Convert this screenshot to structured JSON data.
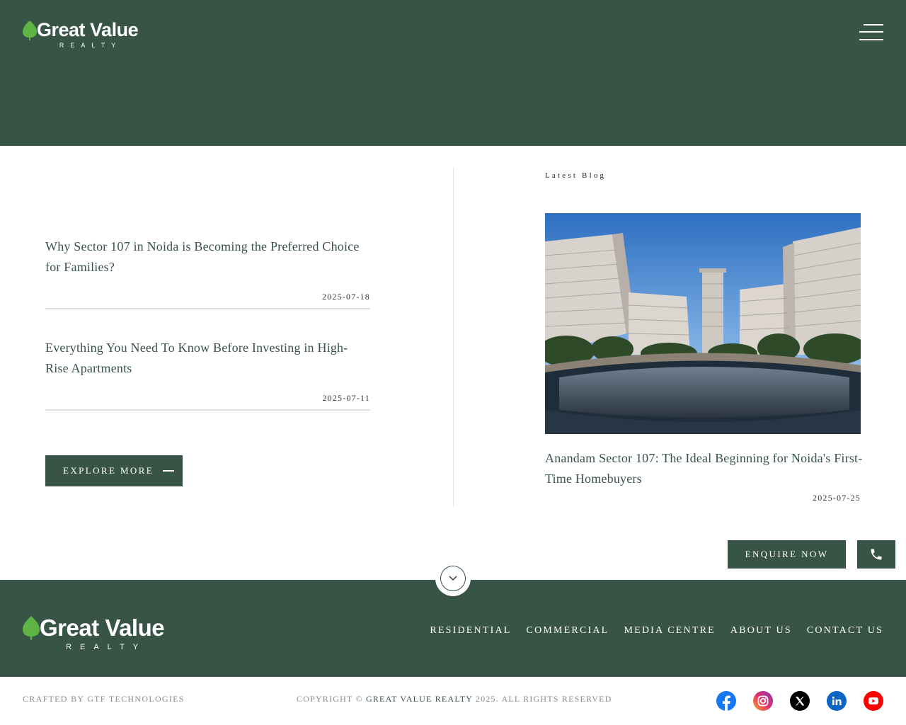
{
  "brand": {
    "name": "Great Value",
    "tagline": "REALTY"
  },
  "header": {
    "menu_icon": "hamburger-menu-icon"
  },
  "blogs": [
    {
      "title": "Why Sector 107 in Noida is Becoming the Preferred Choice for Families?",
      "date": "2025-07-18"
    },
    {
      "title": "Everything You Need To Know Before Investing in High-Rise Apartments",
      "date": "2025-07-11"
    }
  ],
  "explore": {
    "label": "EXPLORE MORE"
  },
  "latest": {
    "label": "Latest Blog",
    "title": "Anandam Sector 107: The Ideal Beginning for Noida's First-Time Homebuyers",
    "date": "2025-07-25"
  },
  "enquire": {
    "label": "ENQUIRE NOW",
    "phone_icon": "phone-icon"
  },
  "footer": {
    "nav": [
      "RESIDENTIAL",
      "COMMERCIAL",
      "MEDIA CENTRE",
      "ABOUT US",
      "CONTACT US"
    ],
    "crafted": "CRAFTED BY GTF TECHNOLOGIES",
    "copyright_prefix": "COPYRIGHT ©",
    "copyright_brand": "GREAT VALUE REALTY",
    "copyright_suffix": "2025. ALL RIGHTS RESERVED",
    "socials": [
      "facebook-icon",
      "instagram-icon",
      "x-icon",
      "linkedin-icon",
      "youtube-icon"
    ]
  },
  "colors": {
    "primary": "#385446",
    "leaf": "#5fb446",
    "muted_text": "#8a8a8a"
  }
}
